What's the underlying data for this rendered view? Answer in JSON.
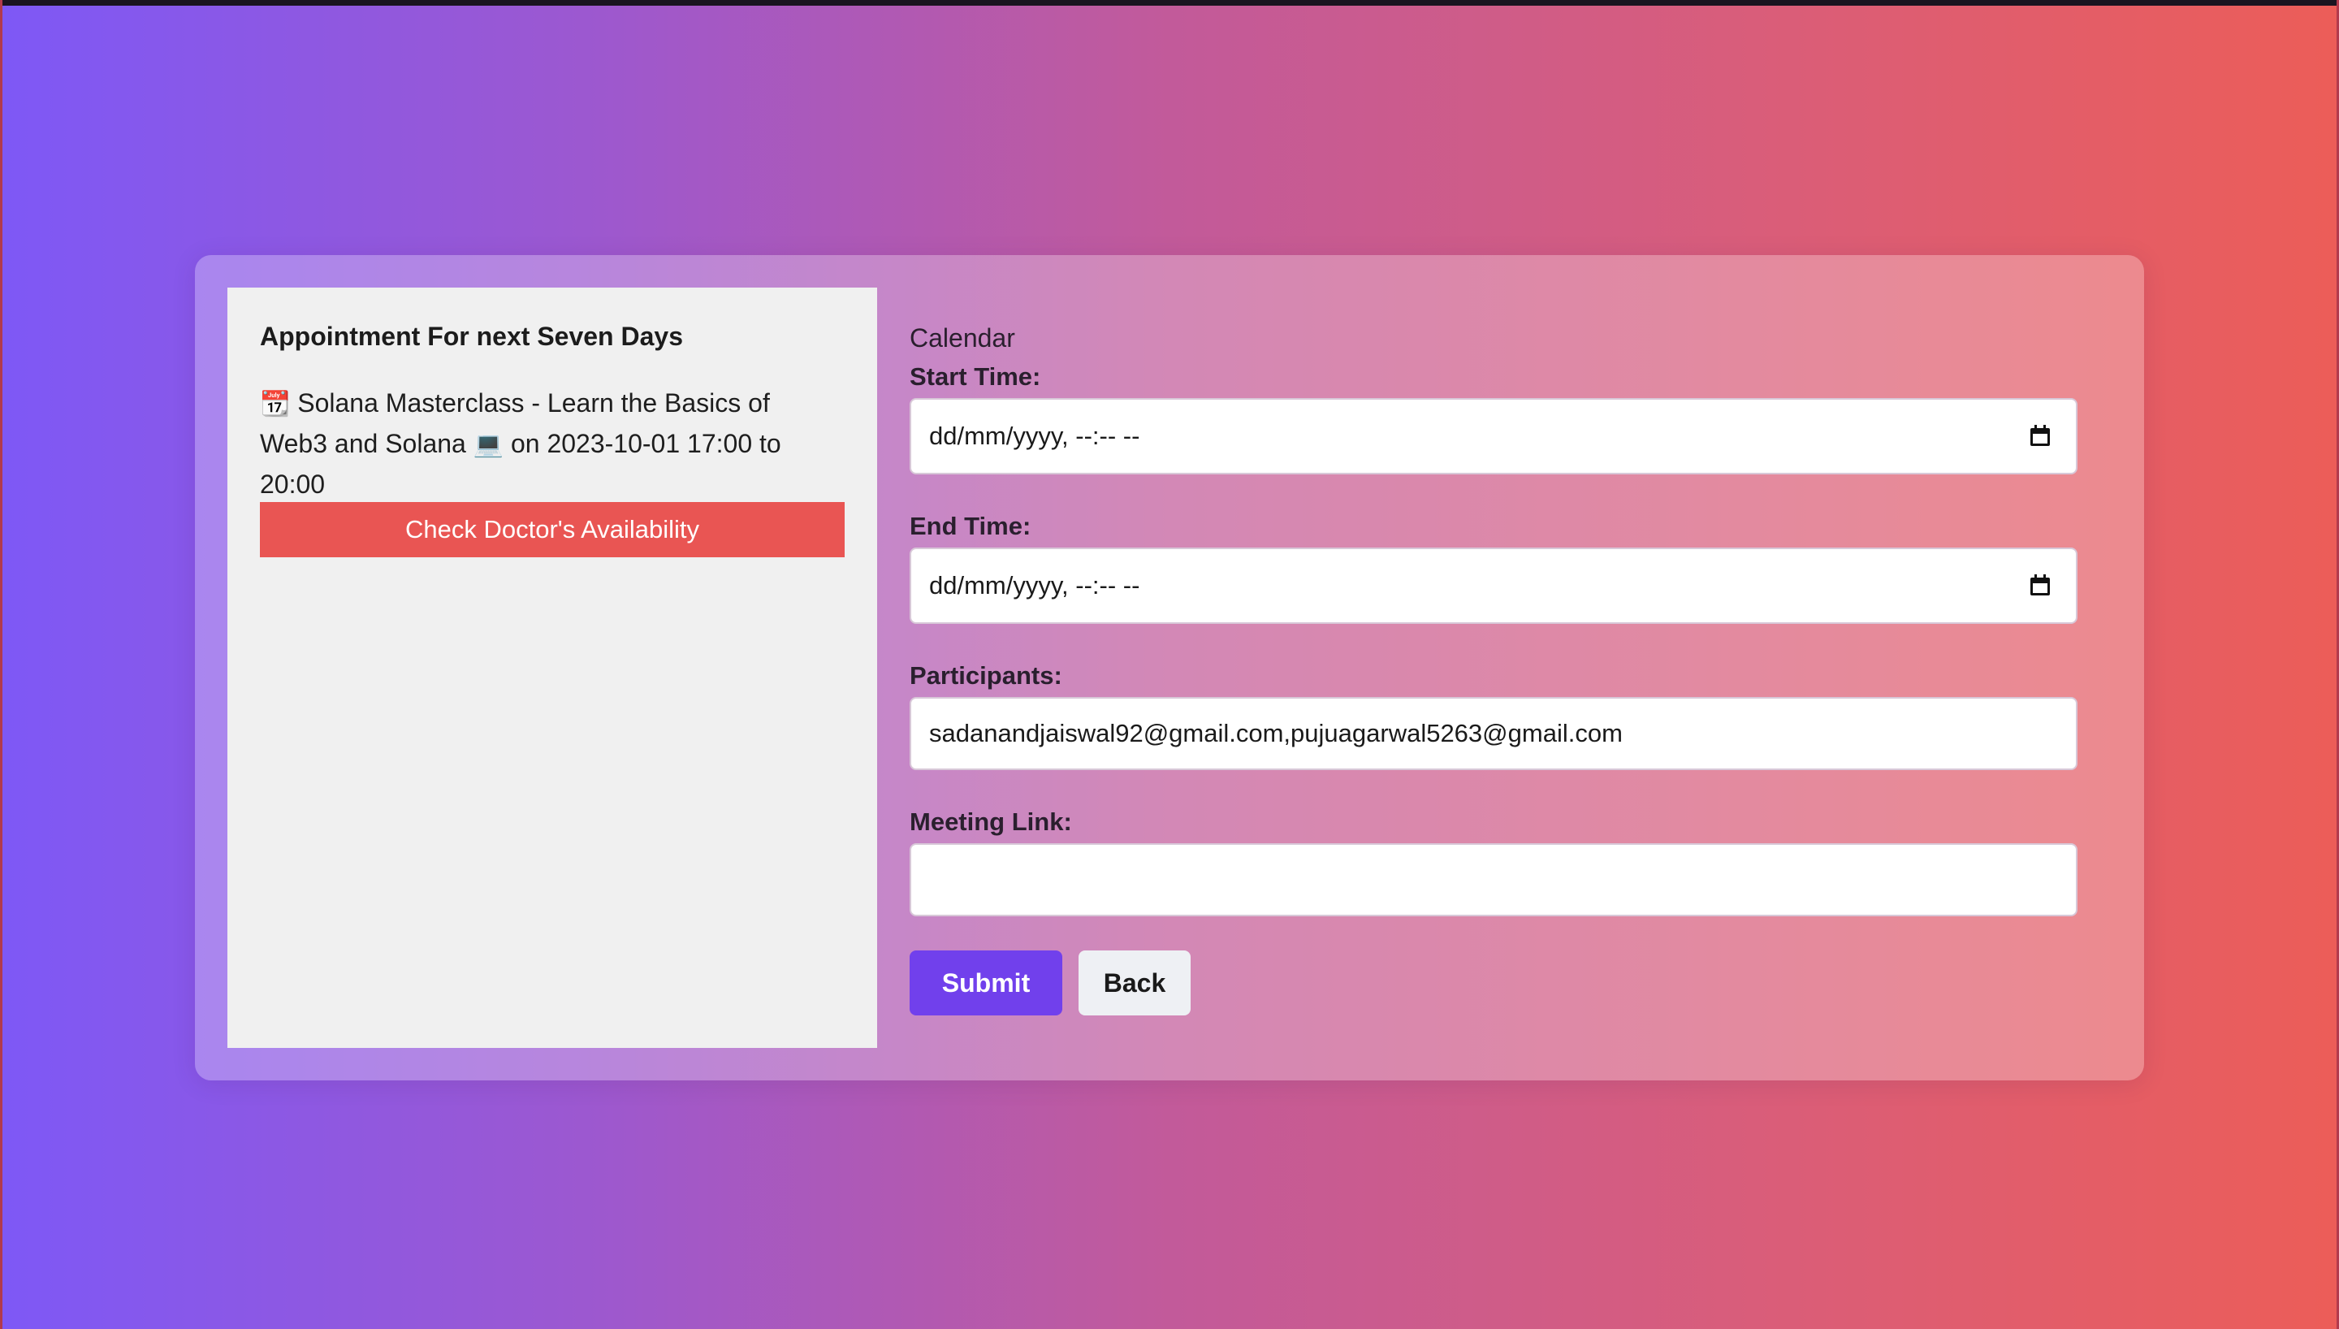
{
  "left": {
    "title": "Appointment For next Seven Days",
    "appointment": {
      "icon_start": "calendar-icon",
      "icon_start_glyph": "📆",
      "part1": "Solana Masterclass - Learn the Basics of Web3 and Solana",
      "icon_mid": "laptop-icon",
      "icon_mid_glyph": "💻",
      "part2": "on 2023-10-01 17:00 to 20:00"
    },
    "check_button": "Check Doctor's Availability"
  },
  "form": {
    "heading": "Calendar",
    "start_label": "Start Time:",
    "start_value": "dd/mm/yyyy, --:-- --",
    "end_label": "End Time:",
    "end_value": "dd/mm/yyyy, --:-- --",
    "participants_label": "Participants:",
    "participants_value": "sadanandjaiswal92@gmail.com,pujuagarwal5263@gmail.com",
    "meeting_label": "Meeting Link:",
    "meeting_value": "",
    "submit": "Submit",
    "back": "Back"
  },
  "colors": {
    "gradient_start": "#7e58f6",
    "gradient_end": "#ec5d58",
    "check_button": "#e95553",
    "submit_button": "#7140ec",
    "back_button": "#eef0f4"
  }
}
